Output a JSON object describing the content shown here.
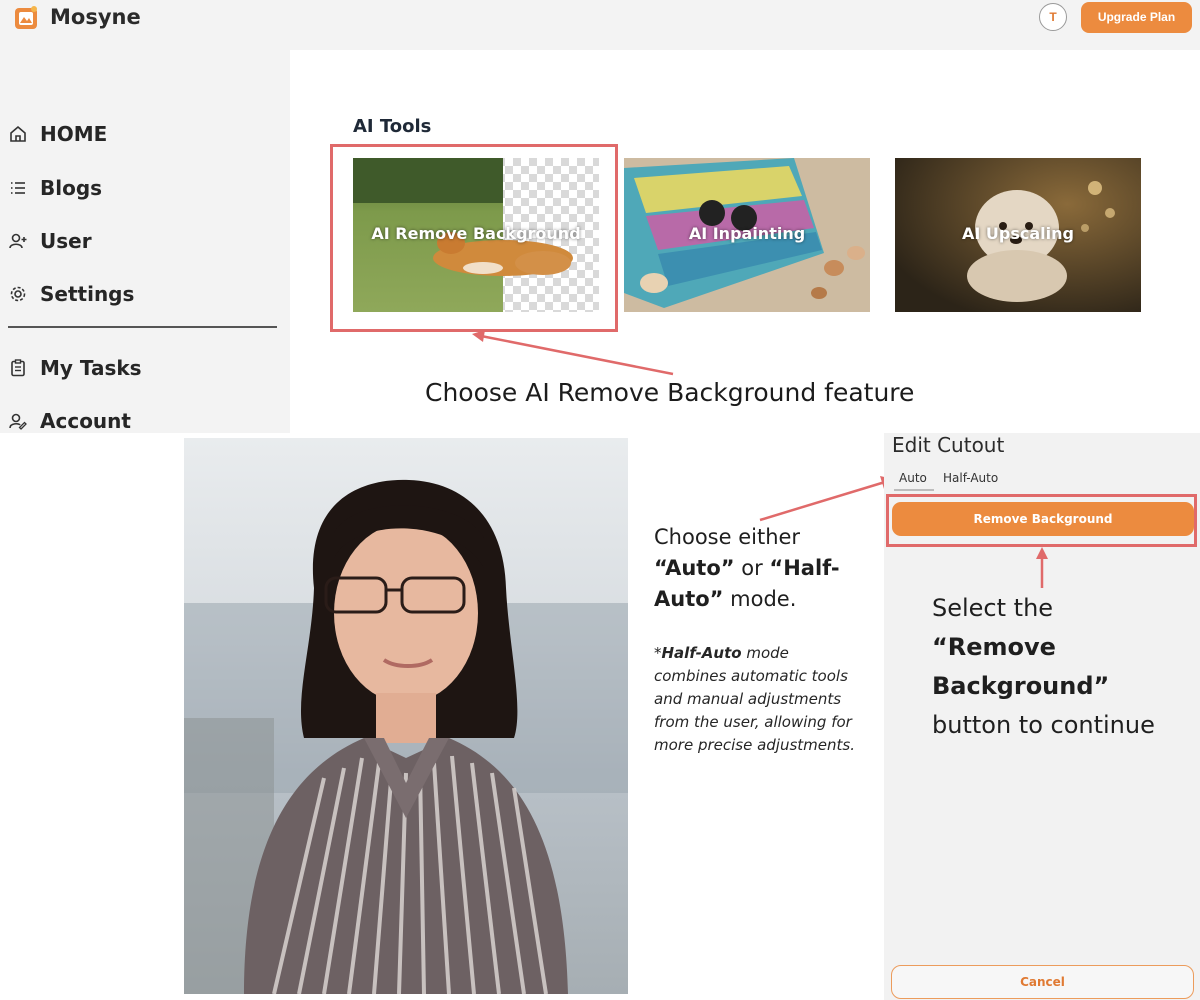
{
  "app": {
    "brand": "Mosyne",
    "avatar_initial": "T",
    "upgrade_label": "Upgrade Plan",
    "accent": "#ec8b3f"
  },
  "sidebar": {
    "items": [
      {
        "label": "HOME",
        "icon": "home-icon"
      },
      {
        "label": "Blogs",
        "icon": "list-icon"
      },
      {
        "label": "User",
        "icon": "user-add-icon"
      },
      {
        "label": "Settings",
        "icon": "gear-icon"
      },
      {
        "label": "My Tasks",
        "icon": "clipboard-icon"
      },
      {
        "label": "Account",
        "icon": "user-edit-icon"
      }
    ]
  },
  "main": {
    "section_title": "AI Tools",
    "tools": [
      {
        "label": "AI Remove Background"
      },
      {
        "label": "AI Inpainting"
      },
      {
        "label": "AI Upscaling"
      }
    ]
  },
  "annotations": {
    "top_caption": "Choose AI Remove Background feature",
    "mode_line1": "Choose either",
    "mode_auto": "“Auto”",
    "mode_or": " or ",
    "mode_half": "“Half-Auto”",
    "mode_end": " mode.",
    "note_prefix": "*",
    "note_bold": "Half-Auto",
    "note_rest": " mode combines automatic tools and manual adjustments from the user, allowing for more precise adjustments.",
    "select_line1": "Select the",
    "select_bold": "“Remove Background”",
    "select_rest": " button to continue",
    "outline_color": "#e06a6a"
  },
  "panel": {
    "title": "Edit Cutout",
    "tabs": [
      "Auto",
      "Half-Auto"
    ],
    "remove_label": "Remove Background",
    "cancel_label": "Cancel"
  }
}
